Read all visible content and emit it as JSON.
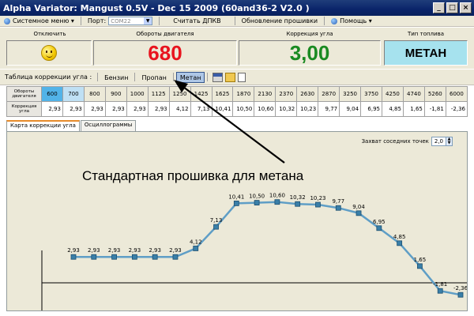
{
  "window": {
    "title": "Alpha Variator: Mangust 0.5V - Dec 15 2009 (60and36-2 V2.0 )",
    "min": "_",
    "max": "□",
    "close": "×"
  },
  "menu": {
    "system": "Системное меню",
    "port_label": "Порт:",
    "port_value": "COM22",
    "read_dpkv": "Считать ДПКВ",
    "update_fw": "Обновление прошивки",
    "help": "Помощь"
  },
  "panel": {
    "disable_label": "Отключить",
    "rpm_label": "Обороты двигателя",
    "rpm_value": "680",
    "angle_label": "Коррекция угла",
    "angle_value": "3,00",
    "fuel_label": "Тип топлива",
    "fuel_value": "МЕТАН",
    "colors": {
      "rpm": "#e8141e",
      "angle": "#1a8a22",
      "fuel_bg": "#a6e2ee"
    }
  },
  "table_strip": {
    "label": "Таблица коррекции угла :",
    "fuels": [
      "Бензин",
      "Пропан",
      "Метан"
    ],
    "active_fuel": "Метан",
    "icons": [
      "save-icon",
      "open-folder-icon",
      "new-file-icon"
    ]
  },
  "grid": {
    "rpm_header": "Обороты двигателя",
    "corr_header": "Коррекция угла",
    "rpm": [
      "600",
      "700",
      "800",
      "900",
      "1000",
      "1125",
      "1250",
      "1425",
      "1625",
      "1870",
      "2130",
      "2370",
      "2630",
      "2870",
      "3250",
      "3750",
      "4250",
      "4740",
      "5260",
      "6000"
    ],
    "corr": [
      "2,93",
      "2,93",
      "2,93",
      "2,93",
      "2,93",
      "2,93",
      "4,12",
      "7,13",
      "10,41",
      "10,50",
      "10,60",
      "10,32",
      "10,23",
      "9,77",
      "9,04",
      "6,95",
      "4,85",
      "1,65",
      "-1,81",
      "-2,36"
    ]
  },
  "tabs": [
    "Карта коррекции угла",
    "Осциллограммы"
  ],
  "capture": {
    "label": "Захват соседних точек",
    "value": "2,0"
  },
  "annotation": "Стандартная прошивка для метана",
  "chart_data": {
    "type": "line",
    "x": [
      "600",
      "700",
      "800",
      "900",
      "1000",
      "1125",
      "1250",
      "1425",
      "1625",
      "1870",
      "2130",
      "2370",
      "2630",
      "2870",
      "3250",
      "3750",
      "4250",
      "4740",
      "5260",
      "6000"
    ],
    "series": [
      {
        "values": [
          2.93,
          2.93,
          2.93,
          2.93,
          2.93,
          2.93,
          4.12,
          7.13,
          10.41,
          10.5,
          10.6,
          10.32,
          10.23,
          9.77,
          9.04,
          6.95,
          4.85,
          1.65,
          -1.81,
          -2.36
        ]
      }
    ],
    "labels": [
      "2,93",
      "2,93",
      "2,93",
      "2,93",
      "2,93",
      "2,93",
      "4,12",
      "7,13",
      "10,41",
      "10,50",
      "10,60",
      "10,32",
      "10,23",
      "9,77",
      "9,04",
      "6,95",
      "4,85",
      "1,65",
      "-1,81",
      "-2,36"
    ],
    "line_color": "#5f9ec6",
    "marker_color": "#3a7fa8",
    "title": "",
    "xlabel": "",
    "ylabel": ""
  }
}
